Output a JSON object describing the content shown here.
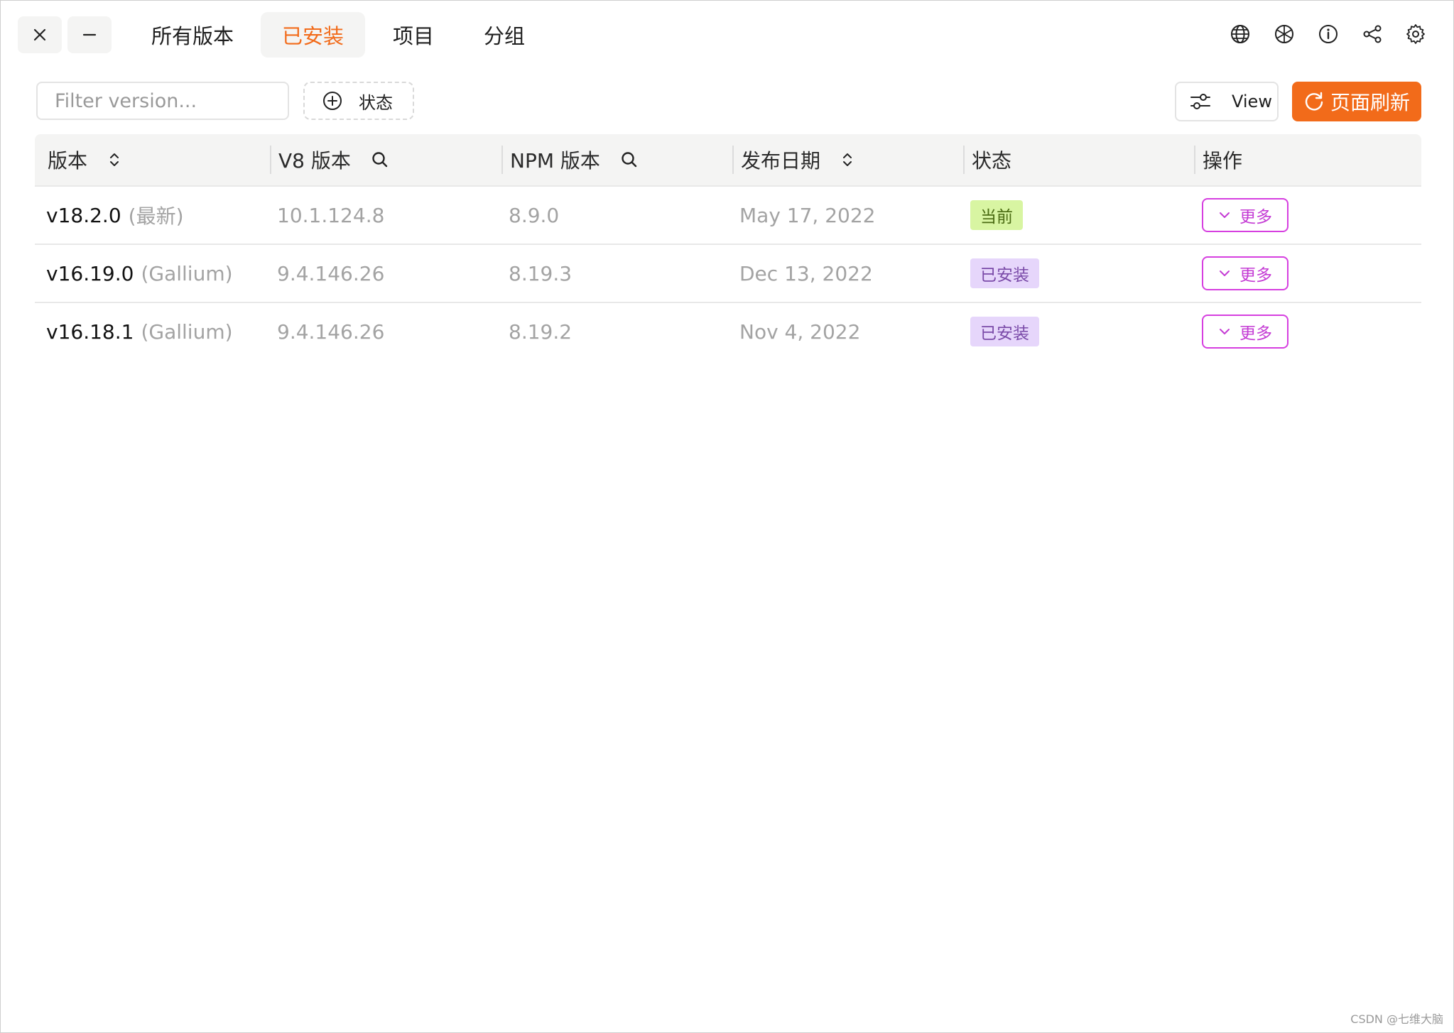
{
  "nav": {
    "tabs": [
      {
        "label": "所有版本"
      },
      {
        "label": "已安装"
      },
      {
        "label": "项目"
      },
      {
        "label": "分组"
      }
    ]
  },
  "toolbar": {
    "filter_placeholder": "Filter version...",
    "status_filter_label": "状态",
    "view_label": "View",
    "refresh_label": "页面刷新"
  },
  "table": {
    "headers": {
      "version": "版本",
      "v8": "V8 版本",
      "npm": "NPM 版本",
      "date": "发布日期",
      "status": "状态",
      "action": "操作"
    },
    "rows": [
      {
        "version": "v18.2.0",
        "alias": "(最新)",
        "v8": "10.1.124.8",
        "npm": "8.9.0",
        "date": "May 17, 2022",
        "status": "当前",
        "action": "更多"
      },
      {
        "version": "v16.19.0",
        "alias": "(Gallium)",
        "v8": "9.4.146.26",
        "npm": "8.19.3",
        "date": "Dec 13, 2022",
        "status": "已安装",
        "action": "更多"
      },
      {
        "version": "v16.18.1",
        "alias": "(Gallium)",
        "v8": "9.4.146.26",
        "npm": "8.19.2",
        "date": "Nov 4, 2022",
        "status": "已安装",
        "action": "更多"
      }
    ]
  },
  "watermark": "CSDN @七维大脑",
  "colors": {
    "accent": "#f26b1a",
    "badge_current_bg": "#d8f5a2",
    "badge_installed_bg": "#e6d6fb",
    "more_border": "#d63fe0"
  },
  "icons": {
    "close": "close-icon",
    "minimize": "minimize-icon",
    "globe": "globe-icon",
    "mirror": "aperture-icon",
    "info": "info-icon",
    "share": "share-icon",
    "settings": "gear-icon"
  }
}
